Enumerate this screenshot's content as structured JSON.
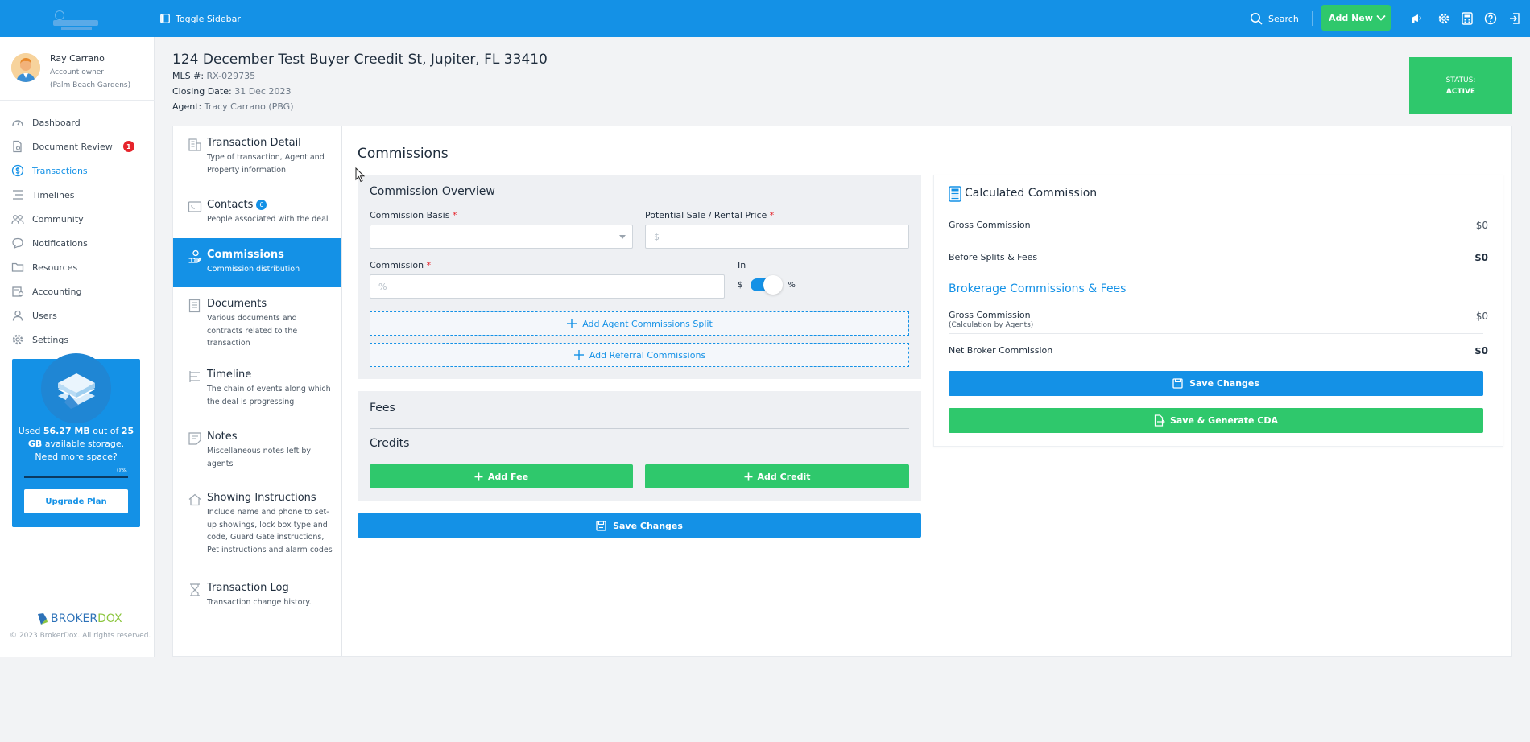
{
  "topbar": {
    "toggle_sidebar": "Toggle Sidebar",
    "search": "Search",
    "add_new": "Add New",
    "accent_color": "#1491e6",
    "add_new_color": "#2fc86c"
  },
  "profile": {
    "name": "Ray Carrano",
    "role": "Account owner",
    "office": "(Palm Beach Gardens)"
  },
  "nav": {
    "items": [
      {
        "label": "Dashboard",
        "icon": "gauge-icon"
      },
      {
        "label": "Document Review",
        "icon": "document-search-icon",
        "badge": "1"
      },
      {
        "label": "Transactions",
        "icon": "dollar-circle-icon"
      },
      {
        "label": "Timelines",
        "icon": "timeline-icon"
      },
      {
        "label": "Community",
        "icon": "community-icon"
      },
      {
        "label": "Notifications",
        "icon": "chat-bubble-icon"
      },
      {
        "label": "Resources",
        "icon": "folder-icon"
      },
      {
        "label": "Accounting",
        "icon": "accounting-icon"
      },
      {
        "label": "Users",
        "icon": "user-icon"
      },
      {
        "label": "Settings",
        "icon": "gear-icon"
      }
    ]
  },
  "storage": {
    "used_prefix": "Used",
    "used_amount": "56.27 MB",
    "out_of": "out of",
    "total": "25 GB",
    "suffix": "available storage.",
    "need_more": "Need more space?",
    "percent_label": "0%",
    "percent_value": 0,
    "upgrade": "Upgrade Plan"
  },
  "footer": {
    "logo_part1": "BROKER",
    "logo_part2": "DOX",
    "copyright": "© 2023 BrokerDox. All rights reserved."
  },
  "transaction": {
    "address": "124 December Test Buyer Creedit St, Jupiter, FL 33410",
    "mls_label": "MLS #:",
    "mls_value": "RX-029735",
    "closing_label": "Closing Date:",
    "closing_value": "31 Dec 2023",
    "agent_label": "Agent:",
    "agent_value": "Tracy Carrano (PBG)",
    "status_label": "STATUS:",
    "status_value": "ACTIVE"
  },
  "sections": [
    {
      "title": "Transaction Detail",
      "desc": "Type of transaction, Agent and Property information",
      "icon": "building-icon"
    },
    {
      "title": "Contacts",
      "badge": "6",
      "desc": "People associated with the deal",
      "icon": "phone-book-icon"
    },
    {
      "title": "Commissions",
      "desc": "Commission distribution",
      "icon": "hand-coin-icon"
    },
    {
      "title": "Documents",
      "desc": "Various documents and contracts related to the transaction",
      "icon": "documents-icon"
    },
    {
      "title": "Timeline",
      "desc": "The chain of events along which the deal is progressing",
      "icon": "timeline-list-icon"
    },
    {
      "title": "Notes",
      "desc": "Miscellaneous notes left by agents",
      "icon": "note-icon"
    },
    {
      "title": "Showing Instructions",
      "desc": "Include name and phone to set-up showings, lock box type and code, Guard Gate instructions, Pet instructions and alarm codes",
      "icon": "house-icon"
    },
    {
      "title": "Transaction Log",
      "desc": "Transaction change history.",
      "icon": "hourglass-icon"
    }
  ],
  "commissions": {
    "title": "Commissions",
    "overview_title": "Commission Overview",
    "basis_label": "Commission Basis",
    "basis_value": "",
    "price_label": "Potential Sale / Rental Price",
    "price_placeholder": "$",
    "commission_label": "Commission",
    "commission_placeholder": "%",
    "in_label": "In",
    "toggle_left": "$",
    "toggle_right": "%",
    "toggle_on": true,
    "add_split": "Add Agent Commissions Split",
    "add_referral": "Add Referral Commissions",
    "fees_title": "Fees",
    "credits_title": "Credits",
    "add_fee": "Add Fee",
    "add_credit": "Add Credit",
    "save": "Save Changes"
  },
  "calculated": {
    "title": "Calculated Commission",
    "gross_label": "Gross Commission",
    "gross_value": "$0",
    "before_label": "Before Splits & Fees",
    "before_value": "$0",
    "brokerage_title": "Brokerage Commissions & Fees",
    "b_gross_label": "Gross Commission",
    "b_gross_sub": "(Calculation by Agents)",
    "b_gross_value": "$0",
    "net_label": "Net Broker Commission",
    "net_value": "$0",
    "save": "Save Changes",
    "save_cda": "Save & Generate CDA"
  }
}
